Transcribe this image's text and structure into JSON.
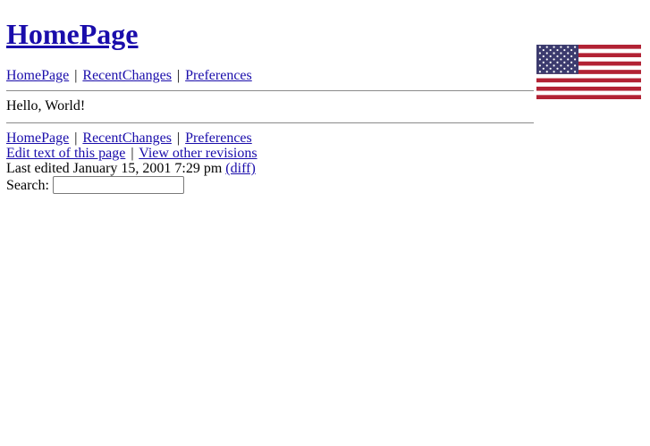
{
  "page": {
    "title": "HomePage"
  },
  "nav_top": {
    "items": [
      {
        "label": "HomePage"
      },
      {
        "label": "RecentChanges"
      },
      {
        "label": "Preferences"
      }
    ],
    "separator": "|"
  },
  "content": {
    "text": "Hello, World!"
  },
  "nav_bottom": {
    "items": [
      {
        "label": "HomePage"
      },
      {
        "label": "RecentChanges"
      },
      {
        "label": "Preferences"
      }
    ],
    "separator": "|"
  },
  "actions": {
    "edit_label": "Edit text of this page",
    "separator": "|",
    "revisions_label": "View other revisions"
  },
  "edit_info": {
    "text": "Last edited January 15, 2001 7:29 pm",
    "diff_label": "(diff)"
  },
  "search": {
    "label": "Search:",
    "value": "",
    "placeholder": ""
  },
  "logo": {
    "icon": "us-flag-icon",
    "colors": {
      "red": "#b22234",
      "white": "#ffffff",
      "blue": "#3c3b6e"
    }
  },
  "colors": {
    "link": "#1a0dab",
    "rule": "#8a8a8a"
  }
}
